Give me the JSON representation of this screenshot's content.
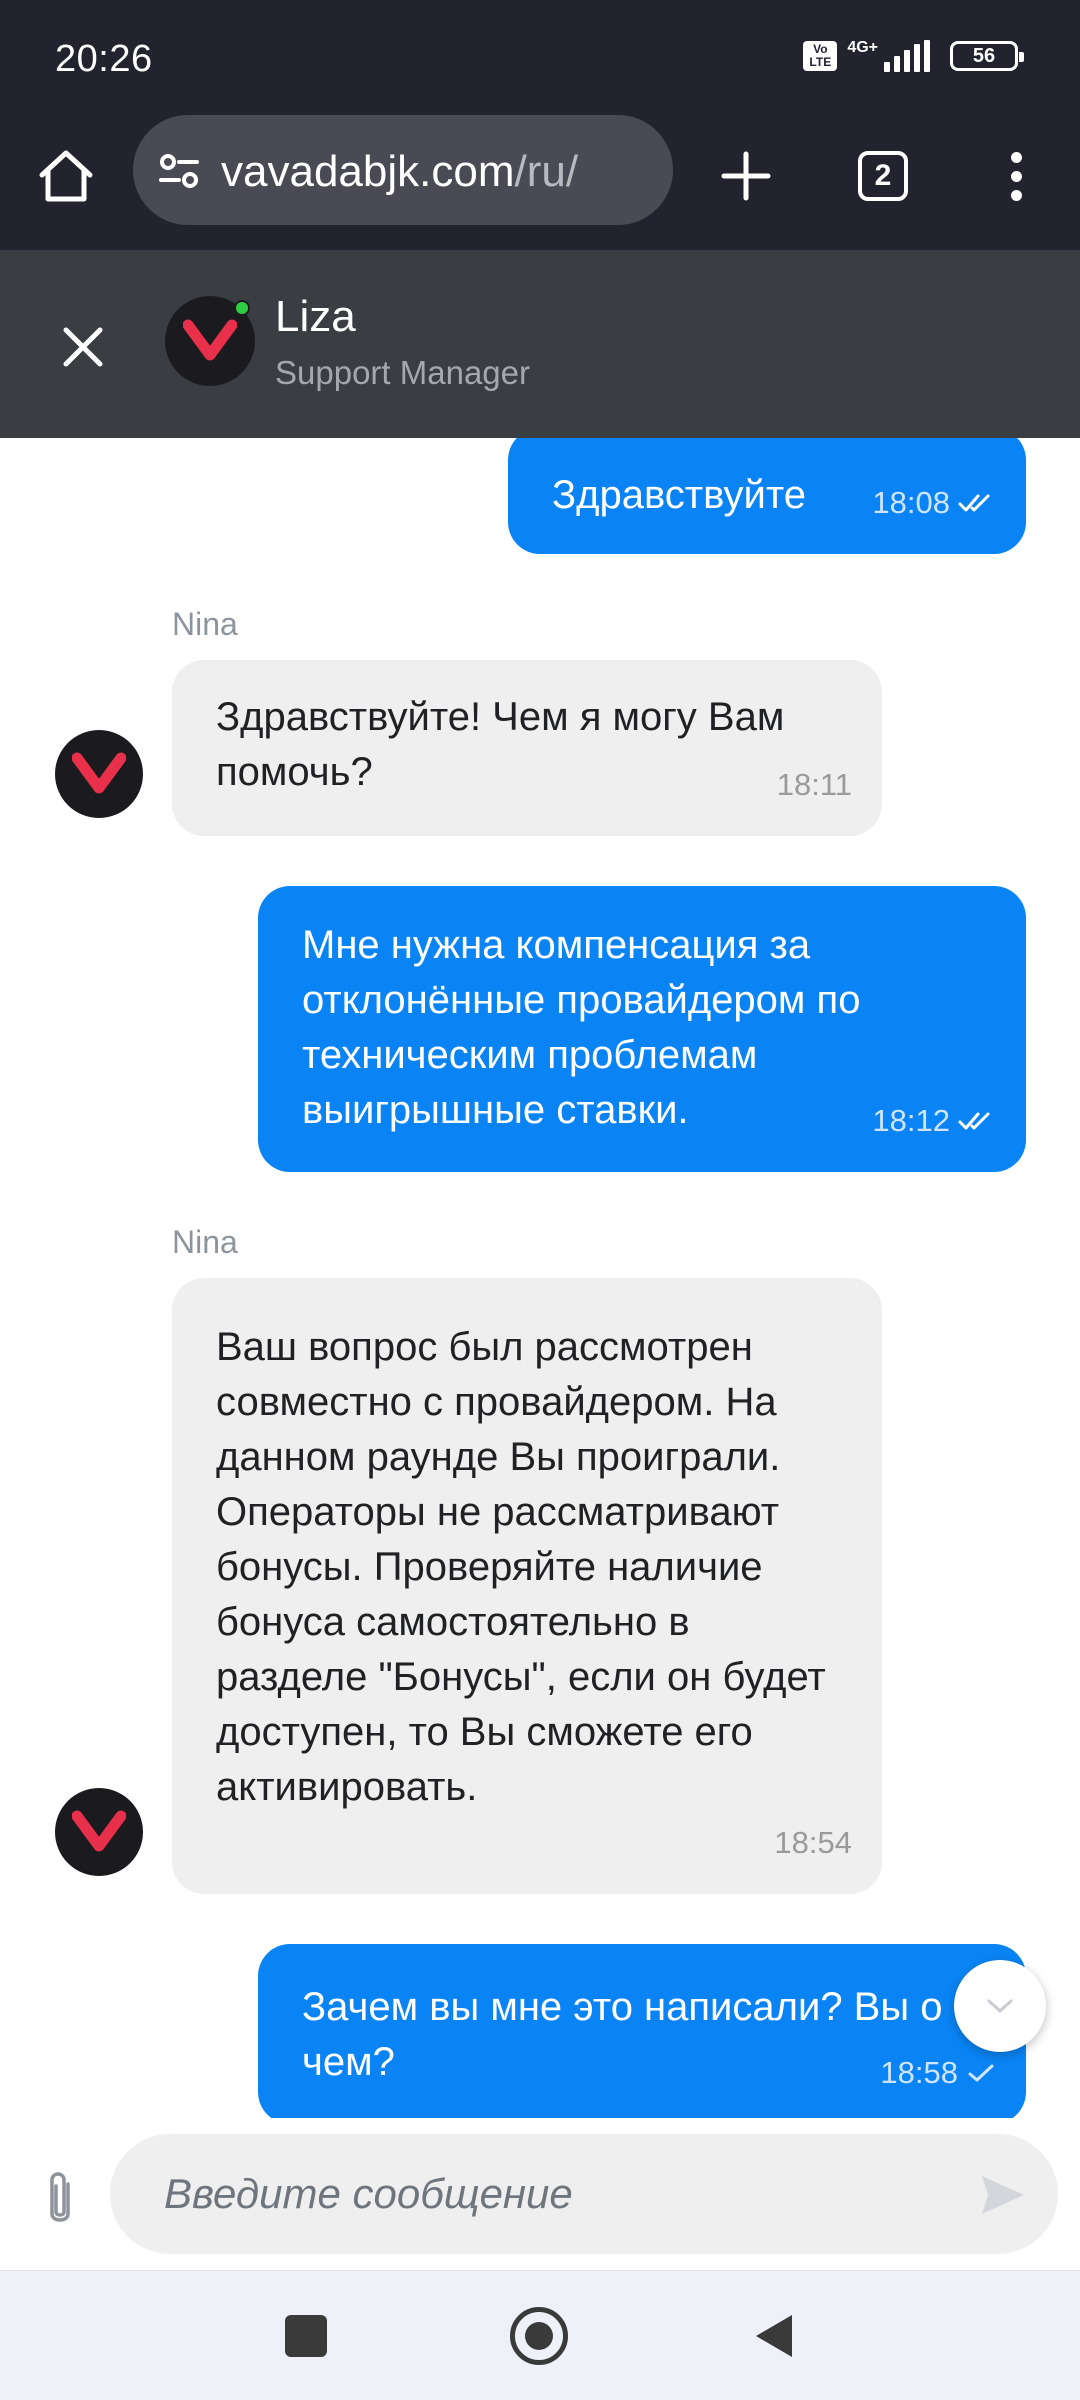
{
  "status_bar": {
    "time": "20:26",
    "volte": "Vo LTE",
    "network": "4G+",
    "battery": "56"
  },
  "browser": {
    "url_host": "vavadabjk.com",
    "url_path": "/ru/",
    "tab_count": "2",
    "icons": [
      "home-icon",
      "tune-icon",
      "plus-icon",
      "tabs-icon",
      "more-vert-icon"
    ]
  },
  "chat_header": {
    "agent_name": "Liza",
    "agent_role": "Support Manager",
    "online": true
  },
  "messages": [
    {
      "direction": "out",
      "text": "Здравствуйте",
      "time": "18:08",
      "status": "read"
    },
    {
      "direction": "in",
      "sender": "Nina",
      "text": "Здравствуйте! Чем я могу Вам помочь?",
      "time": "18:11"
    },
    {
      "direction": "out",
      "text": "Мне нужна компенсация за отклонённые провайдером по техническим проблемам выигрышные ставки.",
      "time": "18:12",
      "status": "read"
    },
    {
      "direction": "in",
      "sender": "Nina",
      "text": "Ваш вопрос был рассмотрен совместно с провайдером. На данном раунде Вы проиграли. Операторы не рассматривают бонусы. Проверяйте наличие бонуса самостоятельно в разделе \"Бонусы\", если он будет доступен, то Вы сможете его активировать.",
      "time": "18:54"
    },
    {
      "direction": "out",
      "text": "Зачем вы мне это написали? Вы о чем?",
      "time": "18:58",
      "status": "sent"
    }
  ],
  "composer": {
    "placeholder": "Введите сообщение",
    "value": ""
  },
  "colors": {
    "system_bar": "#23232f",
    "chat_header": "#3a3d42",
    "outgoing_bubble": "#0a84f5",
    "incoming_bubble": "#efefef",
    "brand_red": "#e8304a"
  }
}
